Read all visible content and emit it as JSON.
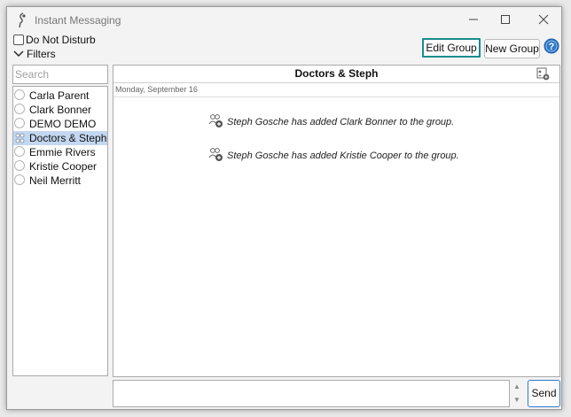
{
  "window": {
    "title": "Instant Messaging"
  },
  "options": {
    "do_not_disturb_label": "Do Not Disturb",
    "do_not_disturb_checked": false,
    "filters_label": "Filters"
  },
  "toolbar": {
    "edit_group_label": "Edit Group",
    "new_group_label": "New Group"
  },
  "search": {
    "placeholder": "Search",
    "value": ""
  },
  "contacts": [
    {
      "name": "Carla Parent",
      "type": "person",
      "selected": false
    },
    {
      "name": "Clark Bonner",
      "type": "person",
      "selected": false
    },
    {
      "name": "DEMO DEMO",
      "type": "person",
      "selected": false
    },
    {
      "name": "Doctors & Steph",
      "type": "group",
      "selected": true
    },
    {
      "name": "Emmie Rivers",
      "type": "person",
      "selected": false
    },
    {
      "name": "Kristie Cooper",
      "type": "person",
      "selected": false
    },
    {
      "name": "Neil Merritt",
      "type": "person",
      "selected": false
    }
  ],
  "chat": {
    "title": "Doctors & Steph",
    "date": "Monday, September 16",
    "messages": [
      {
        "text": "Steph Gosche has added Clark Bonner to the group.",
        "icon": "add-user-icon"
      },
      {
        "text": "Steph Gosche has added Kristie Cooper to the group.",
        "icon": "add-user-icon"
      }
    ]
  },
  "compose": {
    "value": "",
    "send_label": "Send"
  },
  "colors": {
    "accent": "#1a8c8c",
    "selection": "#c3d7f0",
    "send_border": "#2f79c9",
    "help_blue": "#2f79c9"
  }
}
